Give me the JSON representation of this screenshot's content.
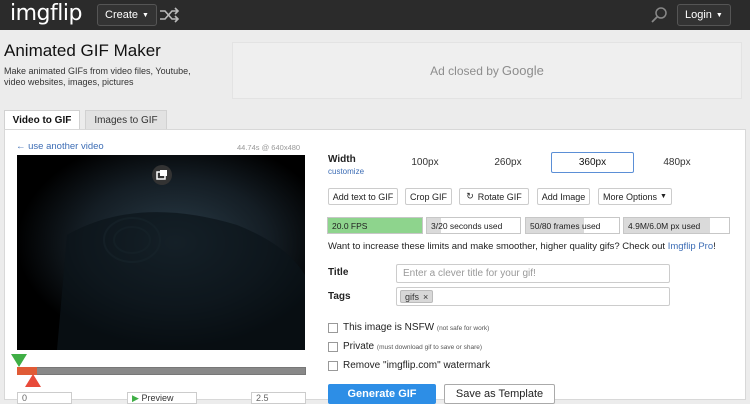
{
  "header": {
    "logo": "imgflip",
    "create_label": "Create",
    "login_label": "Login"
  },
  "page": {
    "title": "Animated GIF Maker",
    "description": "Make animated GIFs from video files, Youtube, video websites, images, pictures"
  },
  "ad": {
    "text": "Ad closed by",
    "brand": "Google"
  },
  "tabs": [
    {
      "label": "Video to GIF",
      "active": true
    },
    {
      "label": "Images to GIF",
      "active": false
    }
  ],
  "video": {
    "use_another": "← use another video",
    "meta": "44.74s @ 640x480",
    "start_value": "0",
    "preview_label": "Preview",
    "end_value": "2.5"
  },
  "width": {
    "label": "Width",
    "customize": "customize",
    "options": [
      "100px",
      "260px",
      "360px",
      "480px"
    ],
    "selected": "360px"
  },
  "tools": [
    "Add text to GIF",
    "Crop GIF",
    "Rotate GIF",
    "Add Image",
    "More Options"
  ],
  "stats": [
    {
      "label": "20.0 FPS",
      "fill": 1.0,
      "color": "#8ed48d"
    },
    {
      "label": "3/20 seconds used",
      "fill": 0.15
    },
    {
      "label": "50/80 frames used",
      "fill": 0.62
    },
    {
      "label": "4.9M/6.0M px used",
      "fill": 0.82
    }
  ],
  "promo": {
    "text": "Want to increase these limits and make smoother, higher quality gifs? Check out",
    "link": "Imgflip Pro",
    "suffix": "!"
  },
  "form": {
    "title_label": "Title",
    "title_placeholder": "Enter a clever title for your gif!",
    "tags_label": "Tags",
    "tag": "gifs",
    "tag_remove": "×"
  },
  "options": [
    {
      "label": "This image is NSFW",
      "note": "(not safe for work)"
    },
    {
      "label": "Private",
      "note": "(must download gif to save or share)"
    },
    {
      "label": "Remove \"imgflip.com\" watermark",
      "note": ""
    }
  ],
  "actions": {
    "generate": "Generate GIF",
    "template": "Save as Template"
  }
}
